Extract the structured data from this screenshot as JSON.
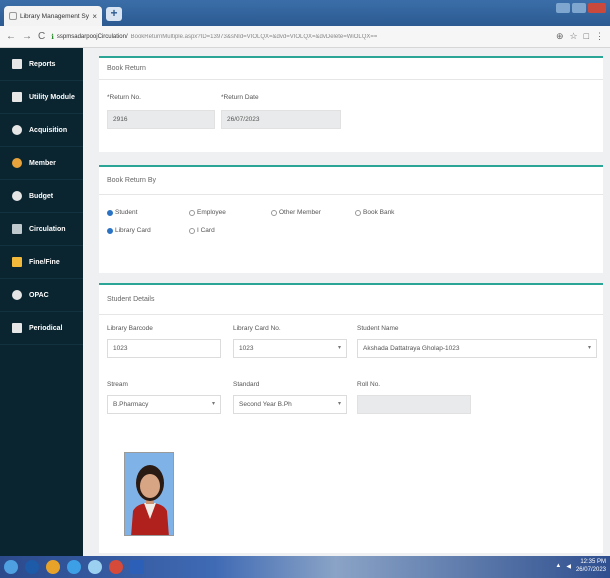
{
  "browser": {
    "tab_title": "Library Management System",
    "tab_close": "×",
    "new_tab": "+",
    "url_host": "sspmsadarpoojCirculation/",
    "url_path": "BookReturnMultiple.aspx?ID=13973&sNId=VIOLQX=&dvd=VIOLQX=&dvDelete=WiOLQX=="
  },
  "sidebar": {
    "items": [
      {
        "label": "Reports",
        "icon": "report-icon"
      },
      {
        "label": "Utility Module",
        "icon": "utility-icon"
      },
      {
        "label": "Acquisition",
        "icon": "acquisition-icon"
      },
      {
        "label": "Member",
        "icon": "member-icon"
      },
      {
        "label": "Budget",
        "icon": "budget-icon"
      },
      {
        "label": "Circulation",
        "icon": "circulation-icon"
      },
      {
        "label": "Fine/Fine",
        "icon": "fine-icon"
      },
      {
        "label": "OPAC",
        "icon": "opac-icon"
      },
      {
        "label": "Periodical",
        "icon": "periodical-icon"
      }
    ]
  },
  "book_return": {
    "title": "Book Return",
    "return_no_label": "*Return No.",
    "return_no_value": "2916",
    "return_date_label": "*Return Date",
    "return_date_value": "26/07/2023"
  },
  "returned_by": {
    "title": "Book Return By",
    "options": [
      {
        "label": "Student",
        "selected": true
      },
      {
        "label": "Employee",
        "selected": false
      },
      {
        "label": "Other Member",
        "selected": false
      },
      {
        "label": "Book Bank",
        "selected": false
      }
    ],
    "card_options": [
      {
        "label": "Library Card",
        "selected": true
      },
      {
        "label": "I Card",
        "selected": false
      }
    ]
  },
  "student_details": {
    "title": "Student Details",
    "barcode_label": "Library Barcode",
    "barcode_value": "1023",
    "card_no_label": "Library Card No.",
    "card_no_value": "1023",
    "name_label": "Student Name",
    "name_value": "Akshada Dattatraya Gholap-1023",
    "stream_label": "Stream",
    "stream_value": "B.Pharmacy",
    "standard_label": "Standard",
    "standard_value": "Second Year B.Ph",
    "rollno_label": "Roll No.",
    "rollno_value": "",
    "dropdown_arrow": "▾"
  },
  "taskbar": {
    "clock_time": "12:35 PM",
    "clock_date": "26/07/2023"
  },
  "colors": {
    "sidebar_bg": "#0b2530",
    "accent": "#2aa596"
  }
}
